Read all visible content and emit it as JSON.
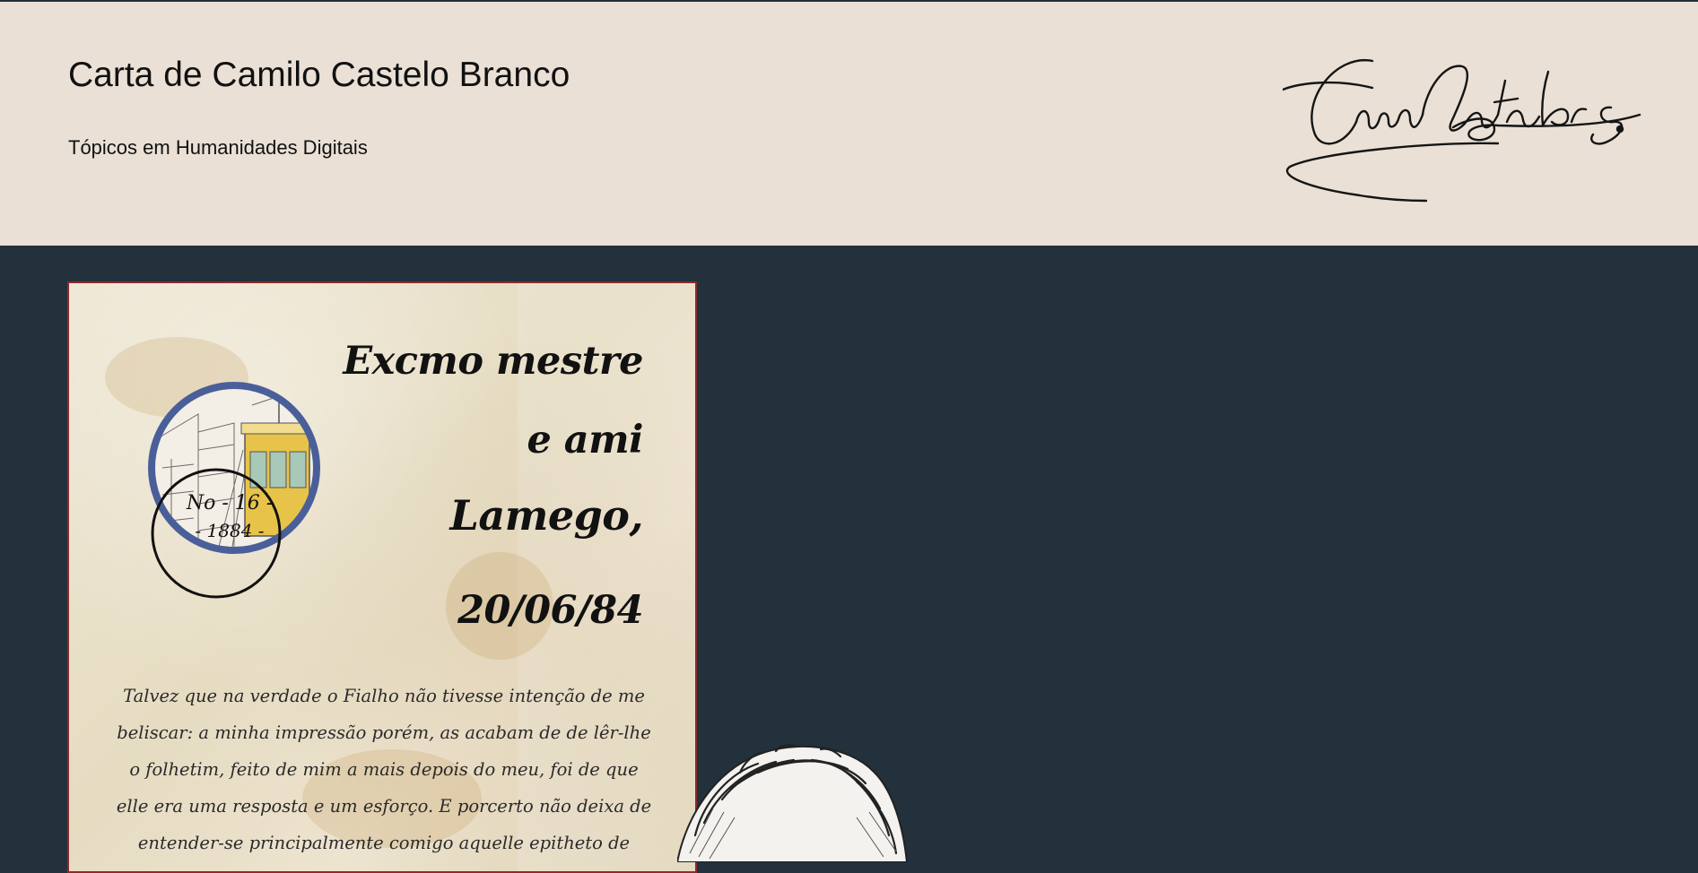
{
  "header": {
    "title": "Carta de Camilo Castelo Branco",
    "subtitle": "Tópicos em Humanidades Digitais",
    "signature_text": "Cam Castelo Br"
  },
  "letter": {
    "greeting_lines": [
      "Excmo mestre",
      "e ami",
      "Lamego,",
      "20/06/84"
    ],
    "stamp_lines": [
      "No - 16 -",
      "- 1884 -"
    ],
    "body": "Talvez que na verdade o Fialho não tivesse intenção de me beliscar: a minha impressão porém, as acabam de de lêr-lhe o folhetim, feito de mim a mais depois do meu, foi de que elle era uma resposta e um esforço. E porcerto não deixa de entender-se principalmente comigo aquelle epitheto de"
  },
  "colors": {
    "header_bg": "#eae0d6",
    "page_bg": "#22313c",
    "letter_border": "#8e2a2a",
    "vignette_ring": "#4a5f9a",
    "tram_yellow": "#e8c34a"
  },
  "icons": {
    "signature": "handwritten-signature-icon",
    "vignette": "tram-illustration-icon",
    "portrait": "portrait-sketch-icon"
  }
}
